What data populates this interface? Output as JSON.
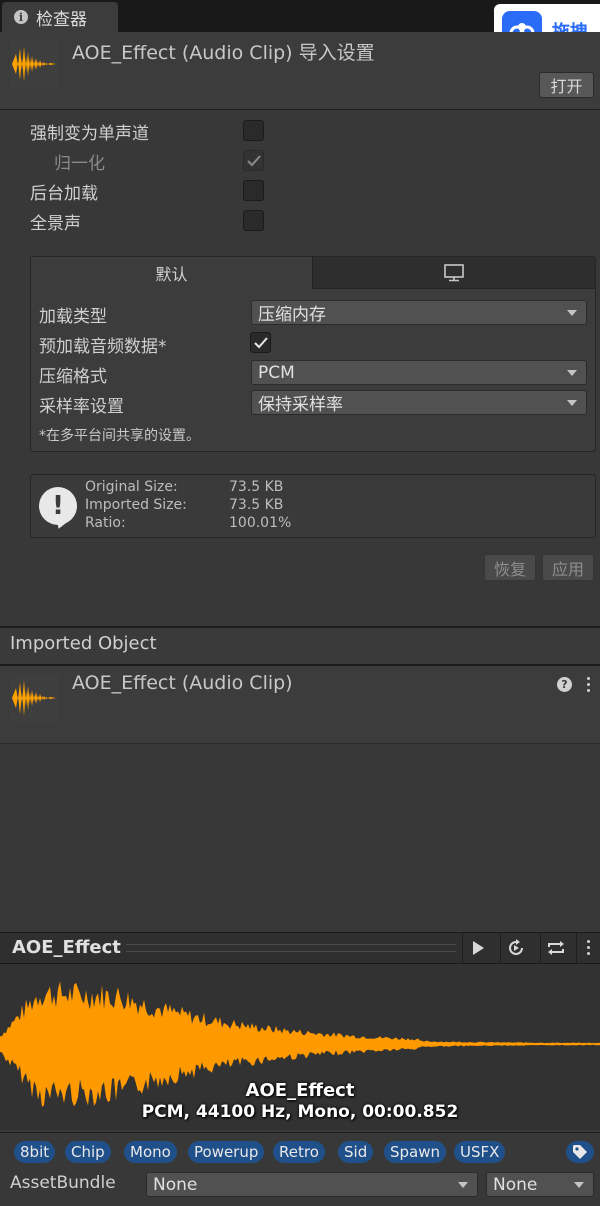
{
  "tab": {
    "label": "检查器",
    "icon": "info-icon"
  },
  "overlay": {
    "label": "拖拽",
    "icon": "baidu-cloud-icon"
  },
  "header": {
    "title": "AOE_Effect (Audio Clip) 导入设置",
    "open_label": "打开"
  },
  "settings": {
    "force_mono": {
      "label": "强制变为单声道",
      "checked": false
    },
    "normalize": {
      "label": "归一化",
      "checked": true,
      "disabled": true
    },
    "load_in_background": {
      "label": "后台加载",
      "checked": false
    },
    "ambisonic": {
      "label": "全景声",
      "checked": false
    }
  },
  "platform": {
    "tabs": [
      {
        "label": "默认",
        "active": true
      },
      {
        "icon": "monitor-icon",
        "active": false
      }
    ],
    "load_type": {
      "label": "加载类型",
      "value": "压缩内存"
    },
    "preload": {
      "label": "预加载音频数据*",
      "checked": true
    },
    "compression": {
      "label": "压缩格式",
      "value": "PCM"
    },
    "sample_rate": {
      "label": "采样率设置",
      "value": "保持采样率"
    },
    "note": "*在多平台间共享的设置。"
  },
  "info": {
    "original_label": "Original Size:",
    "original_value": "73.5 KB",
    "imported_label": "Imported Size:",
    "imported_value": "73.5 KB",
    "ratio_label": "Ratio:",
    "ratio_value": "100.01%"
  },
  "actions": {
    "revert_label": "恢复",
    "apply_label": "应用"
  },
  "imported": {
    "header": "Imported Object",
    "title": "AOE_Effect (Audio Clip)"
  },
  "preview": {
    "name": "AOE_Effect",
    "caption_name": "AOE_Effect",
    "caption_info": "PCM, 44100 Hz, Mono, 00:00.852",
    "wave_color": "#ff9900"
  },
  "labels": [
    "8bit",
    "Chip",
    "Mono",
    "Powerup",
    "Retro",
    "Sid",
    "Spawn",
    "USFX"
  ],
  "assetbundle": {
    "label": "AssetBundle",
    "name_value": "None",
    "variant_value": "None"
  }
}
